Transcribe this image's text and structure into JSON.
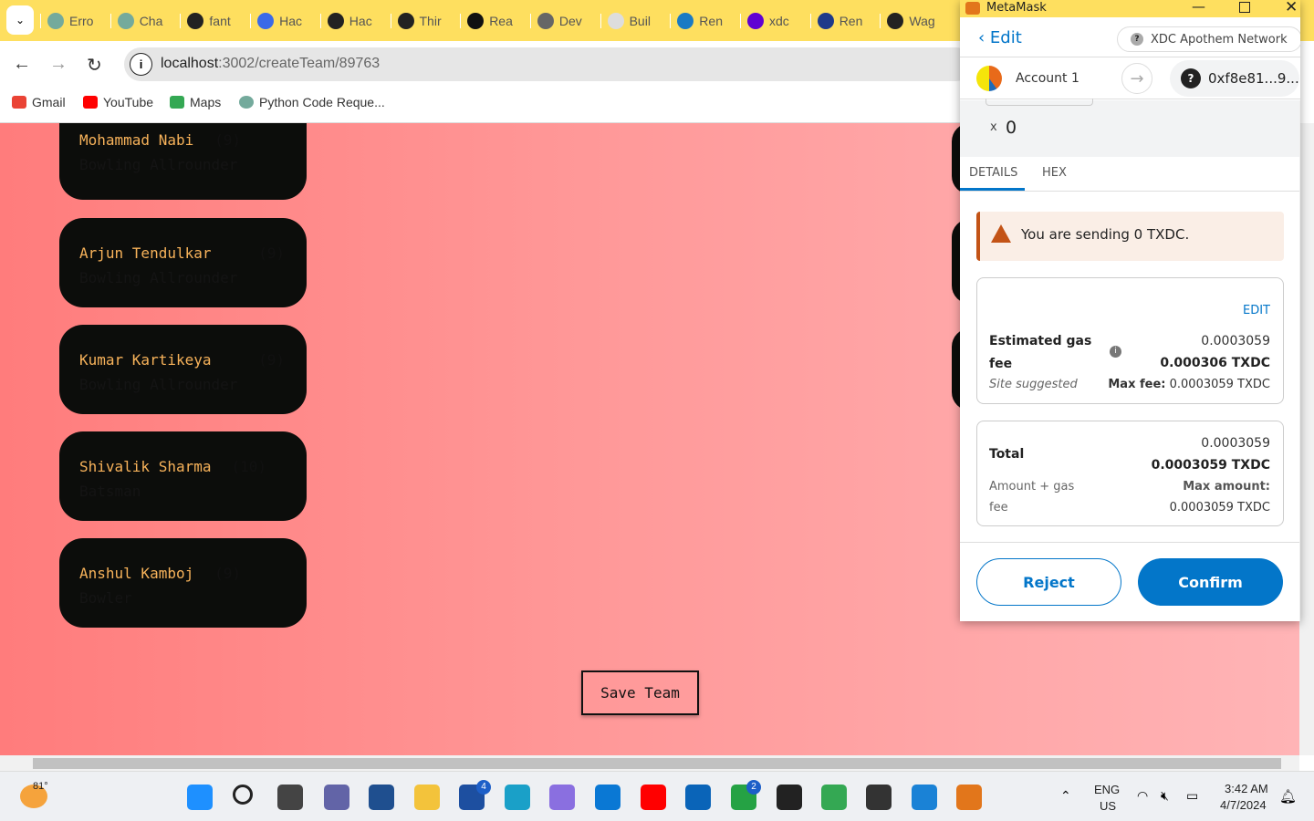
{
  "browser": {
    "tabs": [
      "Erro",
      "Cha",
      "fant",
      "Hac",
      "Hac",
      "Thir",
      "Rea",
      "Dev",
      "Buil",
      "Ren",
      "xdc",
      "Ren",
      "Wag"
    ],
    "url_host": "localhost",
    "url_path": ":3002/createTeam/89763",
    "bookmarks": [
      "Gmail",
      "YouTube",
      "Maps",
      "Python Code Reque..."
    ]
  },
  "players": [
    {
      "name": "Mohammad Nabi",
      "credits": "(9)",
      "role": "Bowling Allrounder"
    },
    {
      "name": "Arjun Tendulkar",
      "credits": "(9)",
      "role": "Bowling Allrounder"
    },
    {
      "name": "Kumar Kartikeya",
      "credits": "(9)",
      "role": "Bowling Allrounder"
    },
    {
      "name": "Shivalik Sharma",
      "credits": "(10)",
      "role": "Batsman"
    },
    {
      "name": "Anshul Kamboj",
      "credits": "(9)",
      "role": "Bowler"
    }
  ],
  "save_label": "Save Team",
  "metamask": {
    "window_title": "MetaMask",
    "back_label": "Edit",
    "network": "XDC Apothem Network",
    "account": "Account 1",
    "to_address": "0xf8e81...9...",
    "multiplier_x": "x",
    "multiplier_value": "0",
    "tabs": [
      "DETAILS",
      "HEX"
    ],
    "warning": "You are sending 0 TXDC.",
    "gas": {
      "edit": "EDIT",
      "label1": "Estimated gas",
      "label2": "fee",
      "sub": "Site suggested",
      "value": "0.0003059",
      "value_bold": "0.000306 TXDC",
      "max_label": "Max fee:",
      "max_value": "0.0003059 TXDC"
    },
    "total": {
      "label": "Total",
      "sub1": "Amount + gas",
      "sub2": "fee",
      "value": "0.0003059",
      "value_bold": "0.0003059 TXDC",
      "max_label": "Max amount:",
      "max_value": "0.0003059 TXDC"
    },
    "reject": "Reject",
    "confirm": "Confirm",
    "accent": "#0376c9"
  },
  "taskbar": {
    "weather": "81°",
    "lang1": "ENG",
    "lang2": "US",
    "time": "3:42 AM",
    "date": "4/7/2024",
    "badge_l": "4",
    "badge_wa": "2"
  }
}
